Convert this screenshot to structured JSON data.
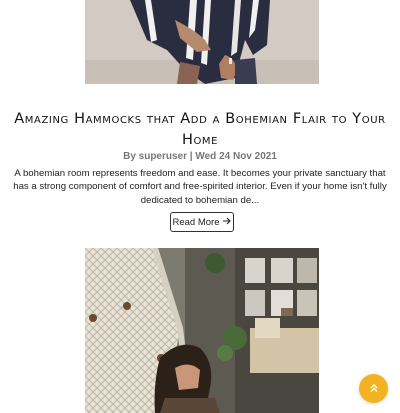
{
  "post": {
    "title": "Amazing Hammocks that Add a Bohemian Flair to Your Home",
    "meta": "By superuser | Wed 24 Nov 2021",
    "excerpt": "A bohemian room represents freedom and ease. It becomes your private sanctuary that has a strong component of comfort and free-spirited interior. Even if your home isn't fully dedicated to bohemian de...",
    "read_more_label": "Read More",
    "read_more_icon": "arrow-right-icon"
  },
  "images": {
    "top": "person-in-striped-poncho-photo",
    "bottom": "macrame-hammock-interior-photo"
  },
  "scroll_top": {
    "icon": "double-chevron-up-icon",
    "color": "#f3b320"
  }
}
